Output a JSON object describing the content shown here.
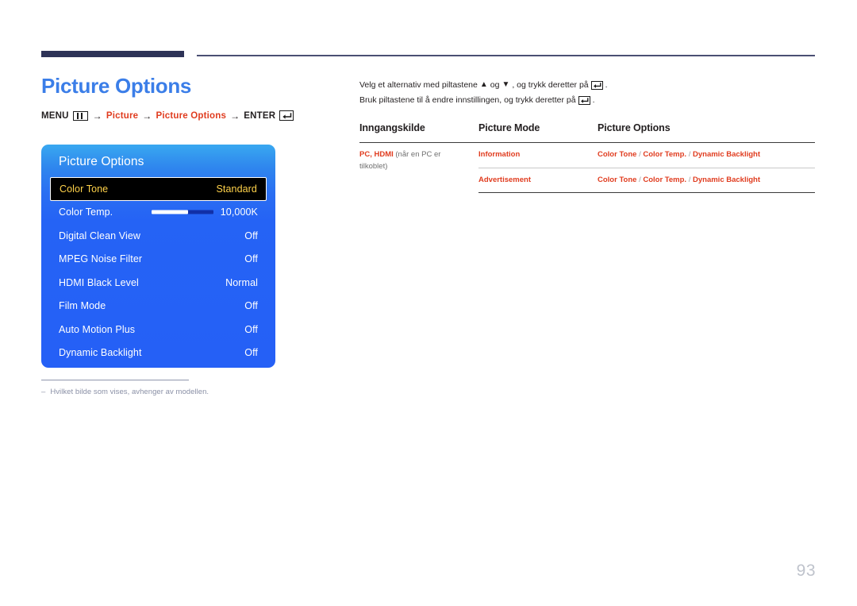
{
  "header": {
    "title": "Picture Options",
    "breadcrumb": {
      "menu_label": "MENU",
      "menu_icon": "menu-bars-icon",
      "arrow": "→",
      "step1": "Picture",
      "step2": "Picture Options",
      "enter_label": "ENTER",
      "enter_icon": "enter-key-icon"
    }
  },
  "osd": {
    "title": "Picture Options",
    "rows": [
      {
        "label": "Color Tone",
        "value": "Standard",
        "selected": true,
        "slider": false
      },
      {
        "label": "Color Temp.",
        "value": "10,000K",
        "selected": false,
        "slider": true
      },
      {
        "label": "Digital Clean View",
        "value": "Off",
        "selected": false,
        "slider": false
      },
      {
        "label": "MPEG Noise Filter",
        "value": "Off",
        "selected": false,
        "slider": false
      },
      {
        "label": "HDMI Black Level",
        "value": "Normal",
        "selected": false,
        "slider": false
      },
      {
        "label": "Film Mode",
        "value": "Off",
        "selected": false,
        "slider": false
      },
      {
        "label": "Auto Motion Plus",
        "value": "Off",
        "selected": false,
        "slider": false
      },
      {
        "label": "Dynamic Backlight",
        "value": "Off",
        "selected": false,
        "slider": false
      }
    ],
    "slider_fill_percent": 59
  },
  "footnote": {
    "dash": "–",
    "text": "Hvilket bilde som vises, avhenger av modellen."
  },
  "instructions": [
    {
      "part1": "Velg et alternativ med piltastene",
      "up_arrow": "▲",
      "conj": "og",
      "down_arrow": "▼",
      "part2": ", og trykk deretter på",
      "period": "."
    },
    {
      "part1": "Bruk piltastene til å endre innstillingen, og trykk deretter på",
      "period": "."
    }
  ],
  "table": {
    "headers": [
      "Inngangskilde",
      "Picture Mode",
      "Picture Options"
    ],
    "rows": [
      {
        "source_highlight": "PC, HDMI",
        "source_rest": " (når en PC er tilkoblet)",
        "mode": "Information",
        "options": "Color Tone / Color Temp. / Dynamic Backlight"
      },
      {
        "source_highlight": "",
        "source_rest": "",
        "mode": "Advertisement",
        "options": "Color Tone / Color Temp. / Dynamic Backlight"
      }
    ]
  },
  "page_number": "93",
  "colors": {
    "title_blue": "#3b7ee8",
    "accent_red": "#e03c1f",
    "rule_navy": "#2e3357",
    "osd_blue": "#2560f6",
    "osd_selected_bg": "#000000",
    "osd_selected_text": "#ffd24a",
    "page_number_gray": "#bfc3cc"
  }
}
